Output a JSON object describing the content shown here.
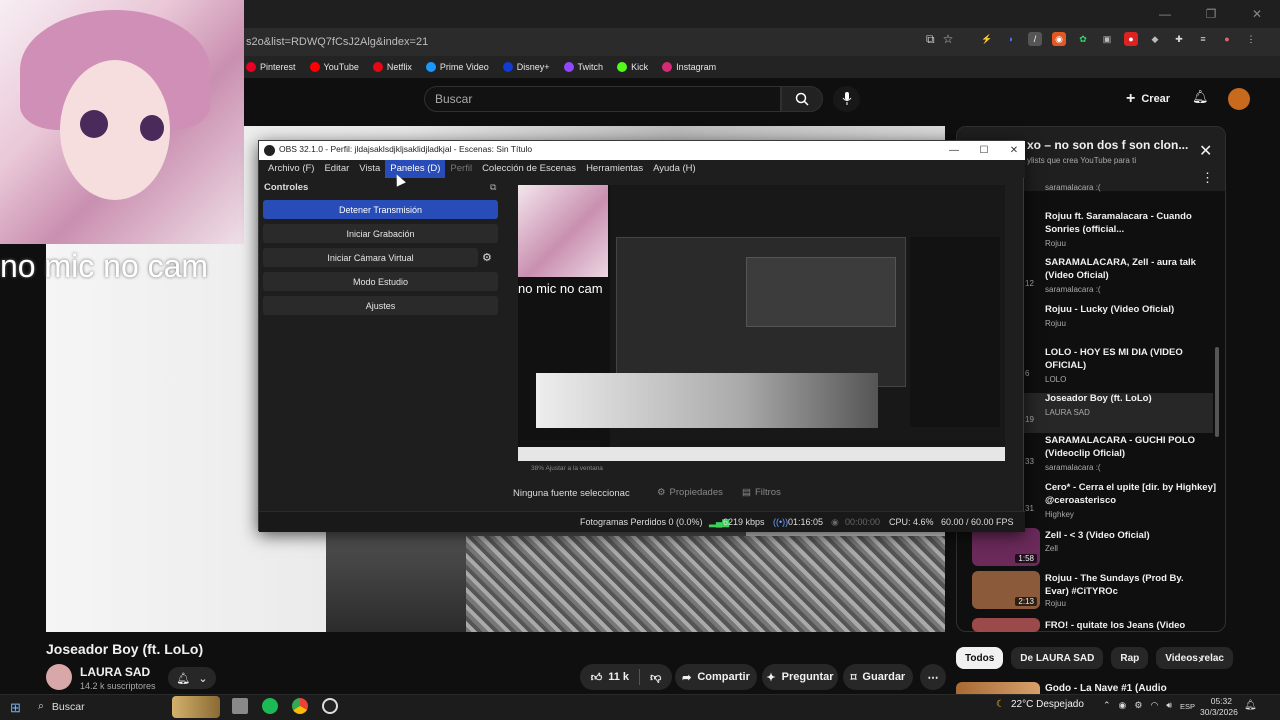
{
  "browser": {
    "url": "s2o&list=RDWQ7fCsJ2Alg&index=21",
    "window_controls": [
      "—",
      "❐",
      "✕"
    ],
    "bookmarks": [
      {
        "label": "Pinterest",
        "color": "#e60023"
      },
      {
        "label": "YouTube",
        "color": "#ff0000"
      },
      {
        "label": "Netflix",
        "color": "#e50914"
      },
      {
        "label": "Prime Video",
        "color": "#1a98ff"
      },
      {
        "label": "Disney+",
        "color": "#113ccf"
      },
      {
        "label": "Twitch",
        "color": "#9146ff"
      },
      {
        "label": "Kick",
        "color": "#53fc18"
      },
      {
        "label": "Instagram",
        "color": "#d62976"
      }
    ]
  },
  "youtube": {
    "search_placeholder": "Buscar",
    "create_label": "Crear",
    "video": {
      "title": "Joseador Boy (ft. LoLo)",
      "channel": "LAURA SAD",
      "subscribers": "14.2 k suscriptores",
      "likes": "11 k",
      "share": "Compartir",
      "ask": "Preguntar",
      "save": "Guardar"
    },
    "webcam_overlay_text": "no mic no cam",
    "playlist": {
      "title": "xo – no son dos f son clon...",
      "subtitle": "ylists que crea YouTube para ti",
      "items": [
        {
          "title": "",
          "channel": "saramalacara :(",
          "num": ""
        },
        {
          "title": "Rojuu ft. Saramalacara - Cuando Sonries (official...",
          "channel": "Rojuu",
          "num": ""
        },
        {
          "title": "SARAMALACARA, Zell - aura talk (Video Oficial)",
          "channel": "saramalacara :(",
          "num": "12"
        },
        {
          "title": "Rojuu - Lucky (Video Oficial)",
          "channel": "Rojuu",
          "num": ""
        },
        {
          "title": "LOLO - HOY ES MI DIA (VIDEO OFICIAL)",
          "channel": "LOLO",
          "num": "6"
        },
        {
          "title": "Joseador Boy (ft. LoLo)",
          "channel": "LAURA SAD",
          "num": "19"
        },
        {
          "title": "SARAMALACARA - GUCHI POLO (Videoclip Oficial)",
          "channel": "saramalacara :(",
          "num": "33"
        },
        {
          "title": "Cero* - Cerra el upite [dir. by Highkey] @ceroasterisco",
          "channel": "Highkey",
          "num": "31"
        }
      ],
      "videos": [
        {
          "title": "Zell - < 3 (Video Oficial)",
          "channel": "Zell",
          "duration": "1:58",
          "color": "#6a2a5a"
        },
        {
          "title": "Rojuu - The Sundays (Prod By. Evar) #CiTYROc",
          "channel": "Rojuu",
          "duration": "2:13",
          "color": "#8a5a3a"
        },
        {
          "title": "FRO! - quitate los Jeans (Video",
          "channel": "",
          "duration": "",
          "color": "#9a4a4a"
        }
      ]
    },
    "chips": [
      "Todos",
      "De LAURA SAD",
      "Rap",
      "Videos relac"
    ],
    "next_video": "Godo - La Nave #1 (Audio"
  },
  "obs": {
    "title": "OBS 32.1.0 - Perfil: jldajsaklsdjkljsaklidjladkjal - Escenas: Sin Título",
    "menu": [
      {
        "label": "Archivo (F)",
        "state": "normal"
      },
      {
        "label": "Editar",
        "state": "normal"
      },
      {
        "label": "Vista",
        "state": "normal"
      },
      {
        "label": "Paneles (D)",
        "state": "hl"
      },
      {
        "label": "Perfil",
        "state": "dim"
      },
      {
        "label": "Colección de Escenas",
        "state": "normal"
      },
      {
        "label": "Herramientas",
        "state": "normal"
      },
      {
        "label": "Ayuda (H)",
        "state": "normal"
      }
    ],
    "controls_title": "Controles",
    "buttons": {
      "stop_stream": "Detener Transmisión",
      "start_record": "Iniciar Grabación",
      "start_vcam": "Iniciar Cámara Virtual",
      "studio_mode": "Modo Estudio",
      "settings": "Ajustes"
    },
    "preview_overlay": "no mic no cam",
    "zoom_text": "38%     Ajustar a la ventana",
    "no_source": "Ninguna fuente seleccionac",
    "properties": "Propiedades",
    "filters": "Filtros",
    "status": {
      "dropped": "Fotogramas Perdidos 0 (0.0%)",
      "bitrate": "6219 kbps",
      "stream_time": "01:16:05",
      "record_time": "00:00:00",
      "cpu": "CPU: 4.6%",
      "fps": "60.00 / 60.00 FPS"
    }
  },
  "taskbar": {
    "search": "Buscar",
    "weather": "22°C  Despejado",
    "lang": "ESP",
    "time": "05:32",
    "date": "30/3/2026"
  }
}
